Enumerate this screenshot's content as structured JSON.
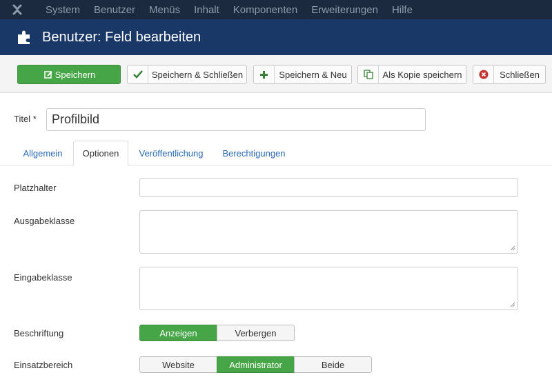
{
  "nav": {
    "items": [
      "System",
      "Benutzer",
      "Menüs",
      "Inhalt",
      "Komponenten",
      "Erweiterungen",
      "Hilfe"
    ]
  },
  "header": {
    "title": "Benutzer: Feld bearbeiten",
    "icon": "puzzle-icon"
  },
  "toolbar": {
    "save": "Speichern",
    "save_close": "Speichern & Schließen",
    "save_new": "Speichern & Neu",
    "save_copy": "Als Kopie speichern",
    "close": "Schließen"
  },
  "form": {
    "title_label": "Titel *",
    "title_value": "Profilbild",
    "tabs": [
      "Allgemein",
      "Optionen",
      "Veröffentlichung",
      "Berechtigungen"
    ],
    "active_tab": "Optionen",
    "placeholder_label": "Platzhalter",
    "placeholder_value": "",
    "output_class_label": "Ausgabeklasse",
    "output_class_value": "",
    "input_class_label": "Eingabeklasse",
    "input_class_value": "",
    "label_label": "Beschriftung",
    "label_options": [
      "Anzeigen",
      "Verbergen"
    ],
    "label_selected": "Anzeigen",
    "scope_label": "Einsatzbereich",
    "scope_options": [
      "Website",
      "Administrator",
      "Beide"
    ],
    "scope_selected": "Administrator"
  },
  "colors": {
    "nav_bg": "#1b2a3f",
    "header_bg": "#1a3867",
    "primary_green": "#46a546",
    "close_red": "#c82f2f",
    "link_blue": "#2a69b8"
  }
}
